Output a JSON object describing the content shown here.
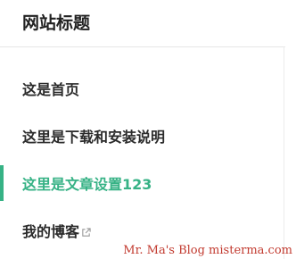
{
  "site": {
    "title": "网站标题"
  },
  "nav": {
    "items": [
      {
        "label": "这是首页",
        "active": false,
        "external": false
      },
      {
        "label": "这里是下载和安装说明",
        "active": false,
        "external": false
      },
      {
        "label": "这里是文章设置123",
        "active": true,
        "external": false
      },
      {
        "label": "我的博客",
        "active": false,
        "external": true
      }
    ]
  },
  "watermark": {
    "text": "Mr. Ma's Blog  misterma.com"
  },
  "colors": {
    "accent": "#36b285",
    "text": "#2b2b2b",
    "watermark": "#c23a2f"
  },
  "icons": {
    "external": "external-link-icon"
  }
}
